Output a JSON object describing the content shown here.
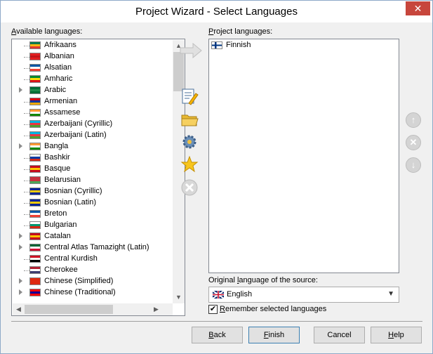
{
  "window": {
    "title": "Project Wizard - Select Languages",
    "close_glyph": "✕"
  },
  "available": {
    "label_prefix": "A",
    "label_rest": "vailable languages:",
    "items": [
      {
        "name": "Afrikaans",
        "expandable": false,
        "flag": [
          "#007a4d",
          "#ffb612",
          "#de3831"
        ]
      },
      {
        "name": "Albanian",
        "expandable": false,
        "flag": [
          "#e41e20",
          "#c0161a",
          "#e41e20"
        ]
      },
      {
        "name": "Alsatian",
        "expandable": false,
        "flag": [
          "#0055a4",
          "#ffffff",
          "#ef4135"
        ]
      },
      {
        "name": "Amharic",
        "expandable": false,
        "flag": [
          "#078930",
          "#fcdd09",
          "#da121a"
        ]
      },
      {
        "name": "Arabic",
        "expandable": true,
        "flag": [
          "#006c35",
          "#1e8a4a",
          "#006c35"
        ]
      },
      {
        "name": "Armenian",
        "expandable": false,
        "flag": [
          "#d90012",
          "#0033a0",
          "#f2a800"
        ]
      },
      {
        "name": "Assamese",
        "expandable": false,
        "flag": [
          "#ff9933",
          "#ffffff",
          "#138808"
        ]
      },
      {
        "name": "Azerbaijani (Cyrillic)",
        "expandable": false,
        "flag": [
          "#00b5e2",
          "#ef3340",
          "#509e2f"
        ]
      },
      {
        "name": "Azerbaijani (Latin)",
        "expandable": false,
        "flag": [
          "#00b5e2",
          "#ef3340",
          "#509e2f"
        ]
      },
      {
        "name": "Bangla",
        "expandable": true,
        "flag": [
          "#ff9933",
          "#ffffff",
          "#138808"
        ]
      },
      {
        "name": "Bashkir",
        "expandable": false,
        "flag": [
          "#ffffff",
          "#0039a6",
          "#d52b1e"
        ]
      },
      {
        "name": "Basque",
        "expandable": false,
        "flag": [
          "#c60b1e",
          "#ffc400",
          "#c60b1e"
        ]
      },
      {
        "name": "Belarusian",
        "expandable": false,
        "flag": [
          "#c8313e",
          "#c8313e",
          "#4aa657"
        ]
      },
      {
        "name": "Bosnian (Cyrillic)",
        "expandable": false,
        "flag": [
          "#002395",
          "#fecb00",
          "#002395"
        ]
      },
      {
        "name": "Bosnian (Latin)",
        "expandable": false,
        "flag": [
          "#002395",
          "#fecb00",
          "#002395"
        ]
      },
      {
        "name": "Breton",
        "expandable": false,
        "flag": [
          "#0055a4",
          "#ffffff",
          "#ef4135"
        ]
      },
      {
        "name": "Bulgarian",
        "expandable": false,
        "flag": [
          "#ffffff",
          "#00966e",
          "#d62612"
        ]
      },
      {
        "name": "Catalan",
        "expandable": true,
        "flag": [
          "#c60b1e",
          "#ffc400",
          "#c60b1e"
        ]
      },
      {
        "name": "Central Atlas Tamazight (Latin)",
        "expandable": true,
        "flag": [
          "#006233",
          "#ffffff",
          "#d21034"
        ]
      },
      {
        "name": "Central Kurdish",
        "expandable": false,
        "flag": [
          "#ce1126",
          "#ffffff",
          "#000000"
        ]
      },
      {
        "name": "Cherokee",
        "expandable": false,
        "flag": [
          "#b22234",
          "#ffffff",
          "#3c3b6e"
        ]
      },
      {
        "name": "Chinese (Simplified)",
        "expandable": true,
        "flag": [
          "#de2910",
          "#de2910",
          "#de2910"
        ]
      },
      {
        "name": "Chinese (Traditional)",
        "expandable": true,
        "flag": [
          "#fe0000",
          "#000095",
          "#fe0000"
        ]
      }
    ]
  },
  "project": {
    "label_prefix": "P",
    "label_rest": "roject languages:",
    "items": [
      {
        "name": "Finnish",
        "flag": [
          "#ffffff",
          "#003580",
          "#ffffff"
        ]
      }
    ]
  },
  "original": {
    "label_pre": "Original ",
    "label_u": "l",
    "label_post": "anguage of the source:",
    "selected": "English",
    "flag": [
      "#012169",
      "#c8102e",
      "#ffffff"
    ]
  },
  "remember": {
    "checked": true,
    "check_glyph": "✔",
    "label_u": "R",
    "label_rest": "emember selected languages"
  },
  "buttons": {
    "back": {
      "u": "B",
      "rest": "ack"
    },
    "finish": {
      "u": "F",
      "rest": "inish"
    },
    "cancel": "Cancel",
    "help": {
      "u": "H",
      "rest": "elp"
    }
  },
  "scroll_glyphs": {
    "up": "▲",
    "down": "▼",
    "left": "◀",
    "right": "▶"
  },
  "side_glyphs": {
    "up": "↑",
    "remove": "✕",
    "down": "↓",
    "combo": "▼"
  },
  "colors": {
    "accent": "#3c7fb1",
    "selection": "#cce8ff"
  }
}
